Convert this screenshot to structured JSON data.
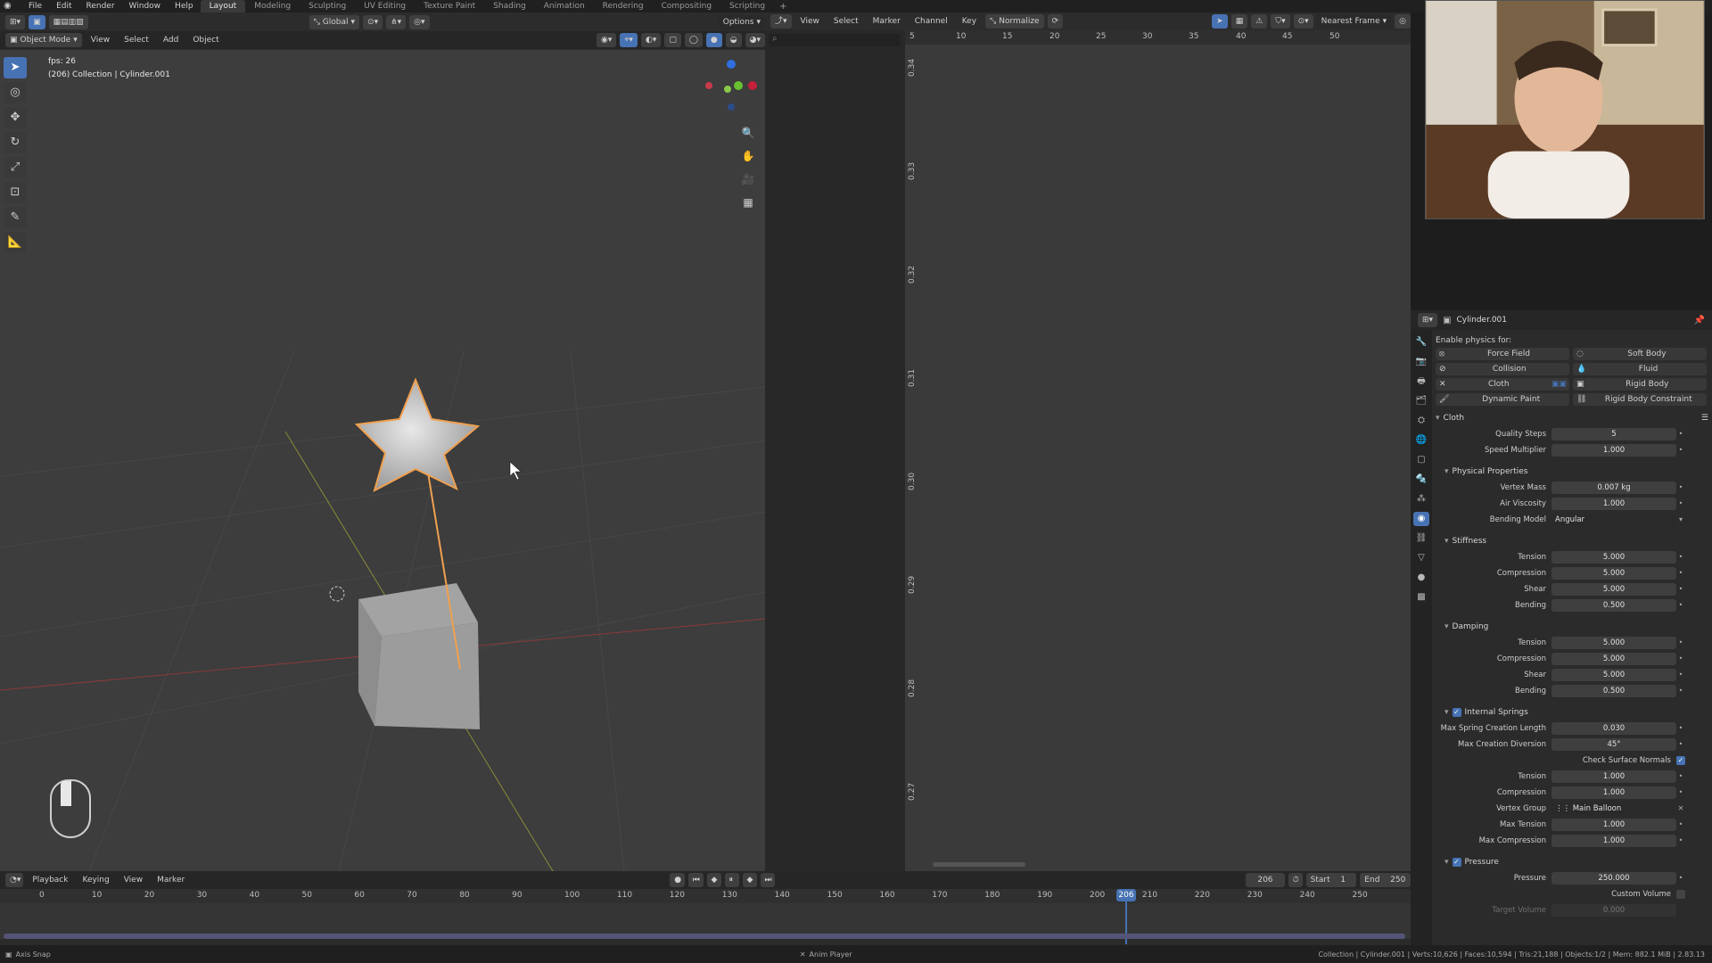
{
  "topbar": {
    "menus": [
      "File",
      "Edit",
      "Render",
      "Window",
      "Help"
    ],
    "workspaces": [
      "Layout",
      "Modeling",
      "Sculpting",
      "UV Editing",
      "Texture Paint",
      "Shading",
      "Animation",
      "Rendering",
      "Compositing",
      "Scripting"
    ],
    "active_workspace": "Layout",
    "add_label": "+"
  },
  "viewport": {
    "header": {
      "orientation": "Global",
      "options_label": "Options",
      "mode": "Object Mode",
      "view": "View",
      "select": "Select",
      "add": "Add",
      "object": "Object"
    },
    "overlay": {
      "fps": "fps: 26",
      "collection": "(206) Collection | Cylinder.001"
    },
    "gizmo_axes": [
      "X",
      "Y",
      "Z"
    ]
  },
  "graph_editor": {
    "menus": [
      "View",
      "Select",
      "Marker",
      "Channel",
      "Key"
    ],
    "normalize": "Normalize",
    "snapping": "Nearest Frame",
    "x_ticks": [
      "5",
      "10",
      "15",
      "20",
      "25",
      "30",
      "35",
      "40",
      "45",
      "50"
    ],
    "y_ticks": [
      "0.34",
      "0.33",
      "0.32",
      "0.31",
      "0.30",
      "0.29",
      "0.28",
      "0.27"
    ]
  },
  "properties": {
    "object_name": "Cylinder.001",
    "enable_physics_label": "Enable physics for:",
    "physics_buttons": [
      {
        "label": "Force Field",
        "icon": "force-field-icon"
      },
      {
        "label": "Soft Body",
        "icon": "soft-body-icon"
      },
      {
        "label": "Collision",
        "icon": "collision-icon"
      },
      {
        "label": "Fluid",
        "icon": "fluid-icon"
      },
      {
        "label": "Cloth",
        "icon": "cloth-icon"
      },
      {
        "label": "Rigid Body",
        "icon": "rigid-body-icon"
      },
      {
        "label": "Dynamic Paint",
        "icon": "dynamic-paint-icon"
      },
      {
        "label": "Rigid Body Constraint",
        "icon": "rigid-body-constraint-icon"
      }
    ],
    "cloth": {
      "title": "Cloth",
      "quality_steps": {
        "label": "Quality Steps",
        "value": "5"
      },
      "speed_multiplier": {
        "label": "Speed Multiplier",
        "value": "1.000"
      },
      "physical": {
        "title": "Physical Properties",
        "vertex_mass": {
          "label": "Vertex Mass",
          "value": "0.007 kg"
        },
        "air_viscosity": {
          "label": "Air Viscosity",
          "value": "1.000"
        },
        "bending_model": {
          "label": "Bending Model",
          "value": "Angular"
        }
      },
      "stiffness": {
        "title": "Stiffness",
        "rows": [
          {
            "label": "Tension",
            "value": "5.000"
          },
          {
            "label": "Compression",
            "value": "5.000"
          },
          {
            "label": "Shear",
            "value": "5.000"
          },
          {
            "label": "Bending",
            "value": "0.500"
          }
        ]
      },
      "damping": {
        "title": "Damping",
        "rows": [
          {
            "label": "Tension",
            "value": "5.000"
          },
          {
            "label": "Compression",
            "value": "5.000"
          },
          {
            "label": "Shear",
            "value": "5.000"
          },
          {
            "label": "Bending",
            "value": "0.500"
          }
        ]
      },
      "internal_springs": {
        "title": "Internal Springs",
        "max_spring_length": {
          "label": "Max Spring Creation Length",
          "value": "0.030"
        },
        "max_creation_diversion": {
          "label": "Max Creation Diversion",
          "value": "45°"
        },
        "check_surface_normals": "Check Surface Normals",
        "tension": {
          "label": "Tension",
          "value": "1.000"
        },
        "compression": {
          "label": "Compression",
          "value": "1.000"
        },
        "vertex_group": {
          "label": "Vertex Group",
          "value": "Main Balloon"
        },
        "max_tension": {
          "label": "Max Tension",
          "value": "1.000"
        },
        "max_compression": {
          "label": "Max Compression",
          "value": "1.000"
        }
      },
      "pressure": {
        "title": "Pressure",
        "pressure": {
          "label": "Pressure",
          "value": "250.000"
        },
        "custom_volume": "Custom Volume",
        "target_volume": {
          "label": "Target Volume",
          "value": "0.000"
        }
      }
    }
  },
  "timeline": {
    "menus": [
      "Playback",
      "Keying",
      "View",
      "Marker"
    ],
    "current_frame": "206",
    "start_label": "Start",
    "start": "1",
    "end_label": "End",
    "end": "250",
    "ticks": [
      "0",
      "10",
      "20",
      "30",
      "40",
      "50",
      "60",
      "70",
      "80",
      "90",
      "100",
      "110",
      "120",
      "130",
      "140",
      "150",
      "160",
      "170",
      "180",
      "190",
      "200",
      "210",
      "220",
      "230",
      "240",
      "250"
    ]
  },
  "statusbar": {
    "left": "Axis Snap",
    "center": "Anim Player",
    "right": "Collection | Cylinder.001 | Verts:10,626 | Faces:10,594 | Tris:21,188 | Objects:1/2 | Mem: 882.1 MiB | 2.83.13"
  },
  "colors": {
    "accent": "#4772b3",
    "selection_outline": "#f0a050",
    "viewport_bg": "#3d3d3d"
  }
}
